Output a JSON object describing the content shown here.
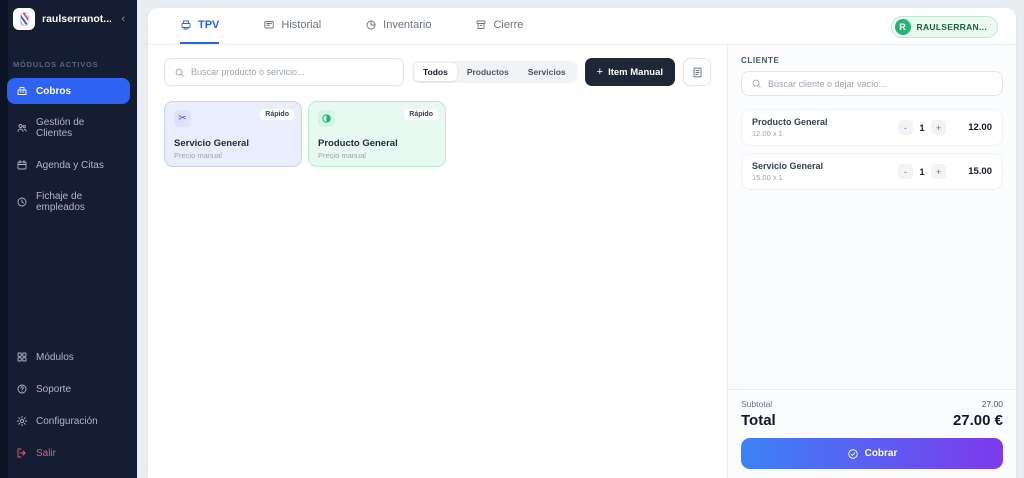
{
  "colors": {
    "sidebar_bg": "#141d31",
    "accent_blue": "#2563eb",
    "active_item_blue": "#2e63f1",
    "success_green": "#22b573",
    "danger_red": "#e5606d",
    "checkout_gradient_start": "#3b82f6",
    "checkout_gradient_end": "#7c3aed",
    "card_blue_bg": "#e9edfc",
    "card_green_bg": "#e7f9f0"
  },
  "sidebar": {
    "workspace_name": "raulserranot...",
    "collapse_glyph": "‹",
    "section_label": "MÓDULOS ACTIVOS",
    "items": [
      {
        "label": "Cobros",
        "icon": "cash-register-icon",
        "active": true
      },
      {
        "label": "Gestión de Clientes",
        "icon": "users-icon"
      },
      {
        "label": "Agenda y Citas",
        "icon": "calendar-icon"
      },
      {
        "label": "Fichaje de empleados",
        "icon": "clock-icon"
      }
    ],
    "footer_items": [
      {
        "label": "Módulos",
        "icon": "grid-icon"
      },
      {
        "label": "Soporte",
        "icon": "help-icon"
      },
      {
        "label": "Configuración",
        "icon": "gear-icon"
      },
      {
        "label": "Salir",
        "icon": "logout-icon",
        "danger": true
      }
    ]
  },
  "header": {
    "tabs": [
      {
        "label": "TPV",
        "icon": "register-icon",
        "active": true
      },
      {
        "label": "Historial",
        "icon": "monitor-icon"
      },
      {
        "label": "Inventario",
        "icon": "pie-chart-icon"
      },
      {
        "label": "Cierre",
        "icon": "archive-icon"
      }
    ],
    "user_badge": {
      "initial": "R",
      "name": "RAULSERRAN..."
    }
  },
  "catalog": {
    "search_placeholder": "Buscar producto o servicio...",
    "filters": [
      "Todos",
      "Productos",
      "Servicios"
    ],
    "active_filter": "Todos",
    "add_item": {
      "plus": "+",
      "label": "Item Manual"
    },
    "cards": [
      {
        "title": "Servicio General",
        "subtitle": "Precio manual",
        "badge": "Rápido",
        "theme": "blue",
        "icon": "scissors-icon",
        "scissors_glyph": "✂"
      },
      {
        "title": "Producto General",
        "subtitle": "Precio manual",
        "badge": "Rápido",
        "theme": "green",
        "icon": "half-circle-icon"
      }
    ]
  },
  "cart": {
    "client_label": "CLIENTE",
    "client_search_placeholder": "Buscar cliente o dejar vacío...",
    "stepper": {
      "minus": "-",
      "plus": "+"
    },
    "items": [
      {
        "name": "Producto General",
        "detail": "12.00 x 1",
        "qty": "1",
        "total": "12.00"
      },
      {
        "name": "Servicio General",
        "detail": "15.00 x 1",
        "qty": "1",
        "total": "15.00"
      }
    ],
    "subtotal_label": "Subtotal",
    "subtotal_value": "27.00",
    "total_label": "Total",
    "total_value": "27.00 €",
    "checkout_label": "Cobrar"
  }
}
